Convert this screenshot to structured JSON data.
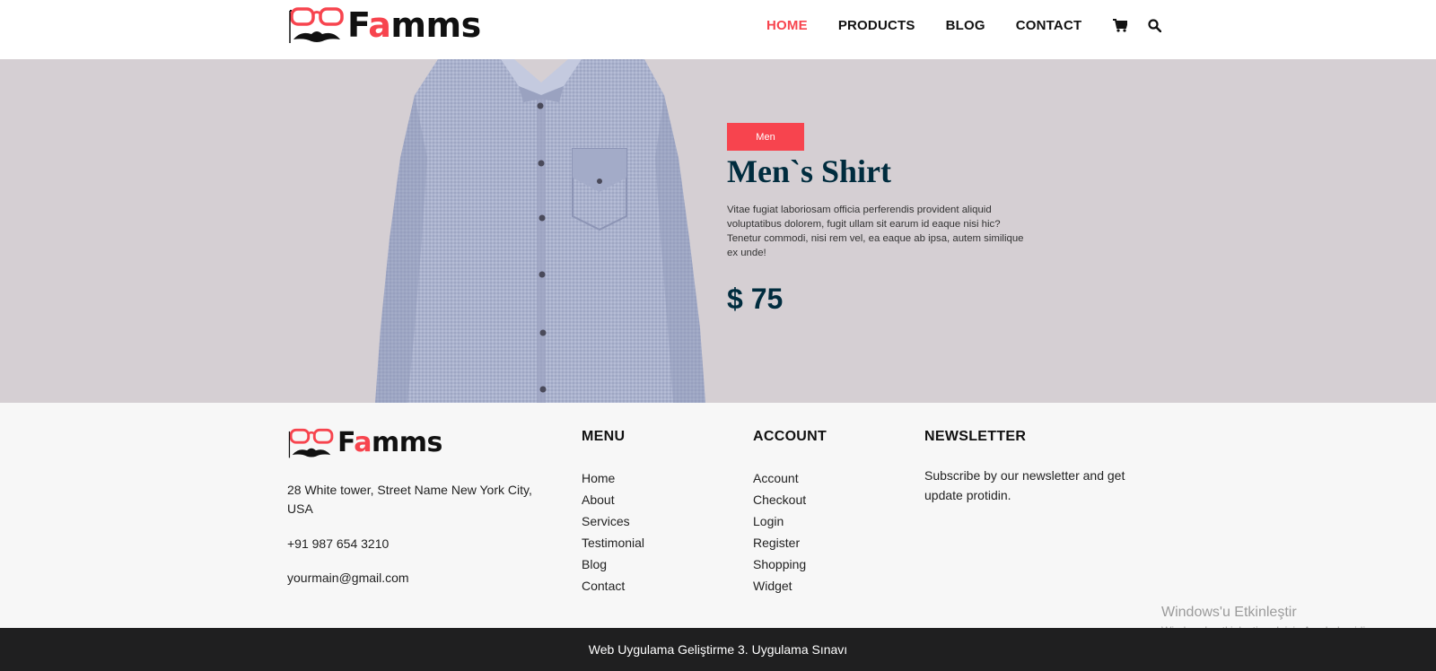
{
  "colors": {
    "accent": "#f7444e",
    "navy": "#002c3e",
    "hero_bg": "#d5cfd3",
    "footer_bg": "#f7f7f7",
    "bottom_bg": "#1f1f20"
  },
  "brand": {
    "name_prefix": "F",
    "name_accent": "a",
    "name_suffix": "mms"
  },
  "nav": {
    "items": [
      {
        "label": "HOME",
        "active": true
      },
      {
        "label": "PRODUCTS",
        "active": false
      },
      {
        "label": "BLOG",
        "active": false
      },
      {
        "label": "CONTACT",
        "active": false
      }
    ],
    "icons": [
      "cart-icon",
      "search-icon"
    ]
  },
  "hero": {
    "badge": "Men",
    "title": "Men`s Shirt",
    "description": "Vitae fugiat laboriosam officia perferendis provident aliquid voluptatibus dolorem, fugit ullam sit earum id eaque nisi hic? Tenetur commodi, nisi rem vel, ea eaque ab ipsa, autem similique ex unde!",
    "price": "$ 75"
  },
  "footer": {
    "address": "28 White tower, Street Name New York City, USA",
    "phone": "+91 987 654 3210",
    "email": "yourmain@gmail.com",
    "menu": {
      "title": "MENU",
      "items": [
        "Home",
        "About",
        "Services",
        "Testimonial",
        "Blog",
        "Contact"
      ]
    },
    "account": {
      "title": "ACCOUNT",
      "items": [
        "Account",
        "Checkout",
        "Login",
        "Register",
        "Shopping",
        "Widget"
      ]
    },
    "newsletter": {
      "title": "NEWSLETTER",
      "text": "Subscribe by our newsletter and get update protidin."
    }
  },
  "watermark": {
    "line1": "Windows'u Etkinleştir",
    "line2": "Windows'u etkinleştirmek için Ayarlar'a gidin."
  },
  "bottom_bar": {
    "text": "Web Uygulama Geliştirme 3. Uygulama Sınavı"
  }
}
